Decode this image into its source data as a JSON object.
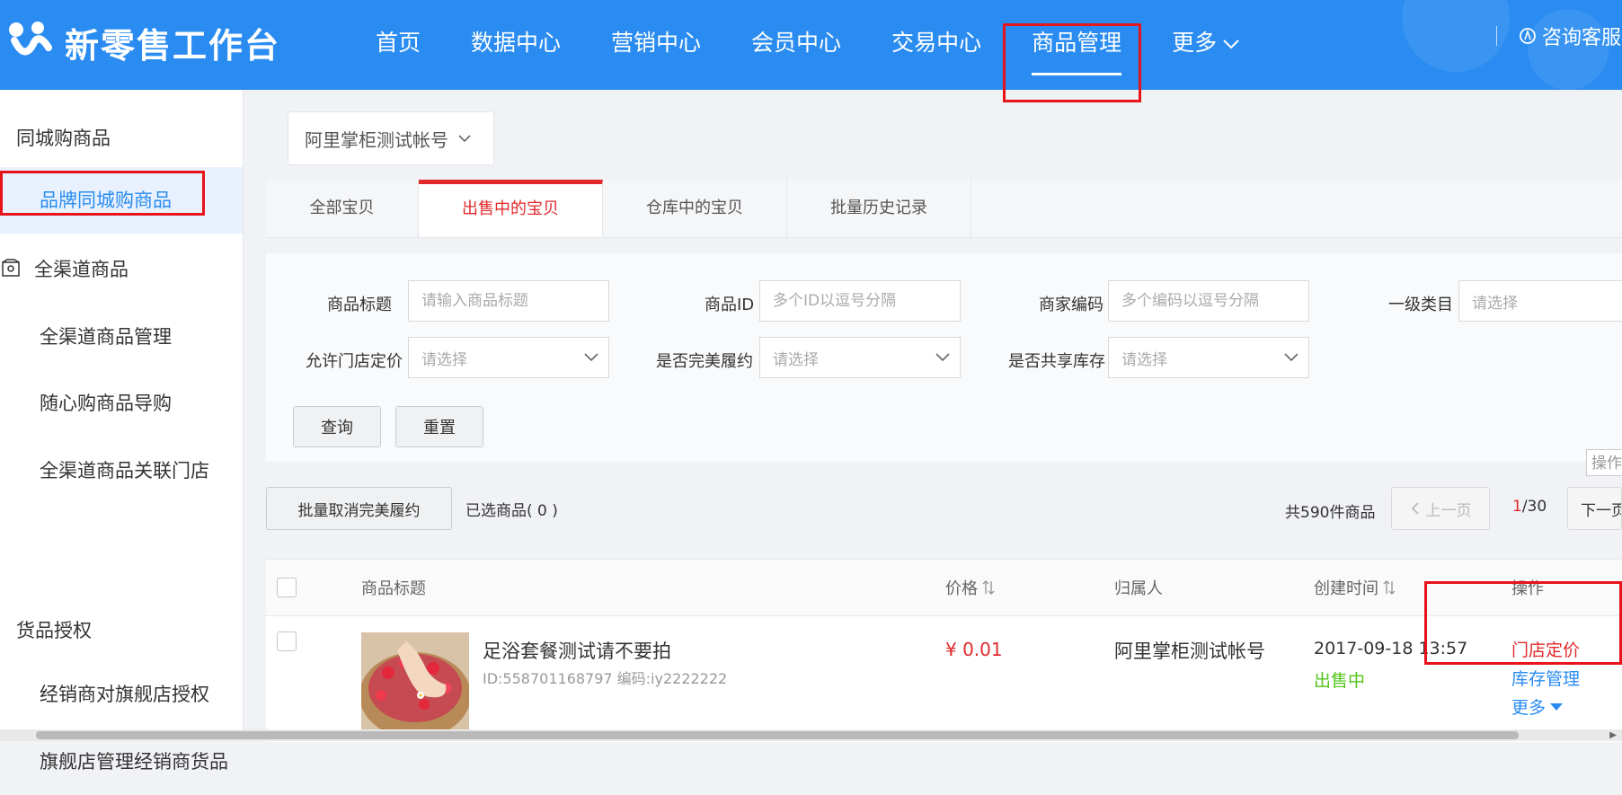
{
  "app": {
    "title": "新零售工作台"
  },
  "nav": {
    "items": [
      "首页",
      "数据中心",
      "营销中心",
      "会员中心",
      "交易中心",
      "商品管理",
      "更多"
    ],
    "active": "商品管理"
  },
  "header": {
    "support_label": "咨询客服"
  },
  "sidebar": {
    "group1": "同城购商品",
    "item_brand": "品牌同城购商品",
    "group2": "全渠道商品",
    "items_omni": [
      "全渠道商品管理",
      "随心购商品导购",
      "全渠道商品关联门店"
    ],
    "group3": "货品授权",
    "items_auth": [
      "经销商对旗舰店授权",
      "旗舰店管理经销商货品"
    ]
  },
  "account": {
    "name": "阿里掌柜测试帐号"
  },
  "tabs": [
    "全部宝贝",
    "出售中的宝贝",
    "仓库中的宝贝",
    "批量历史记录"
  ],
  "filters": {
    "title_label": "商品标题",
    "title_placeholder": "请输入商品标题",
    "id_label": "商品ID",
    "id_placeholder": "多个ID以逗号分隔",
    "code_label": "商家编码",
    "code_placeholder": "多个编码以逗号分隔",
    "category_label": "一级类目",
    "category_value": "请选择",
    "store_price_label": "允许门店定价",
    "store_price_value": "请选择",
    "perfect_label": "是否完美履约",
    "perfect_value": "请选择",
    "shared_stock_label": "是否共享库存",
    "shared_stock_value": "请选择",
    "query_button": "查询",
    "reset_button": "重置"
  },
  "ops_tip": "操作",
  "toolbar": {
    "bulk_cancel": "批量取消完美履约",
    "selected": "已选商品( 0 )",
    "total": "共590件商品",
    "prev": "上一页",
    "page_current": "1",
    "page_total": "/30",
    "next": "下一页"
  },
  "table": {
    "headers": {
      "title": "商品标题",
      "price": "价格",
      "owner": "归属人",
      "created": "创建时间",
      "ops": "操作"
    },
    "rows": [
      {
        "title": "足浴套餐测试请不要拍",
        "meta": "ID:558701168797 编码:iy2222222",
        "price": "¥ 0.01",
        "owner": "阿里掌柜测试帐号",
        "created": "2017-09-18 13:57",
        "status": "出售中",
        "op_price": "门店定价",
        "op_stock": "库存管理",
        "op_more": "更多"
      }
    ]
  }
}
